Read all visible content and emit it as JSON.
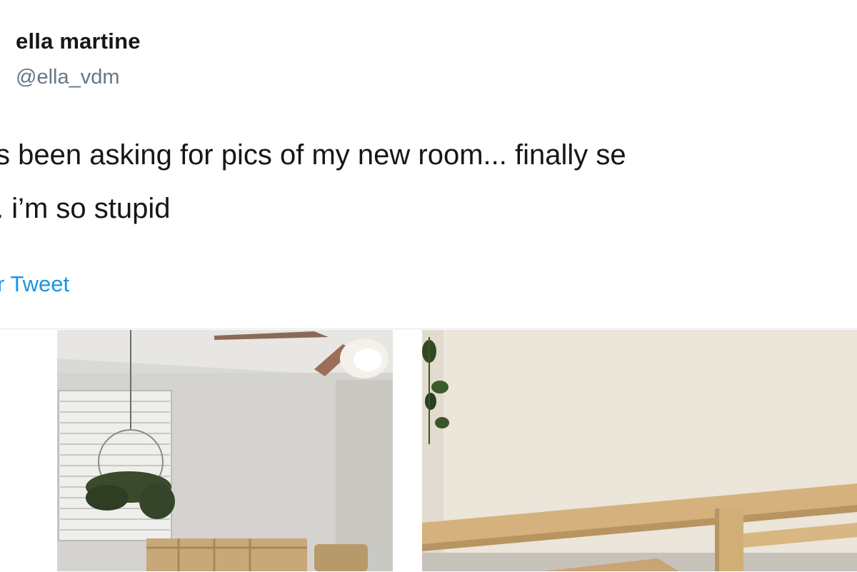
{
  "tweet": {
    "author_name": "ella martine",
    "author_handle": "@ella_vdm",
    "text_line_1": "s been asking for pics of my new room... finally se",
    "text_line_2": ". i’m so stupid",
    "translate_label": "r Tweet"
  },
  "media": {
    "photos": [
      {
        "icon": "room-photo-1"
      },
      {
        "icon": "room-photo-2"
      }
    ]
  },
  "colors": {
    "link": "#1b95e0",
    "handle": "#657786",
    "text": "#14171a"
  }
}
